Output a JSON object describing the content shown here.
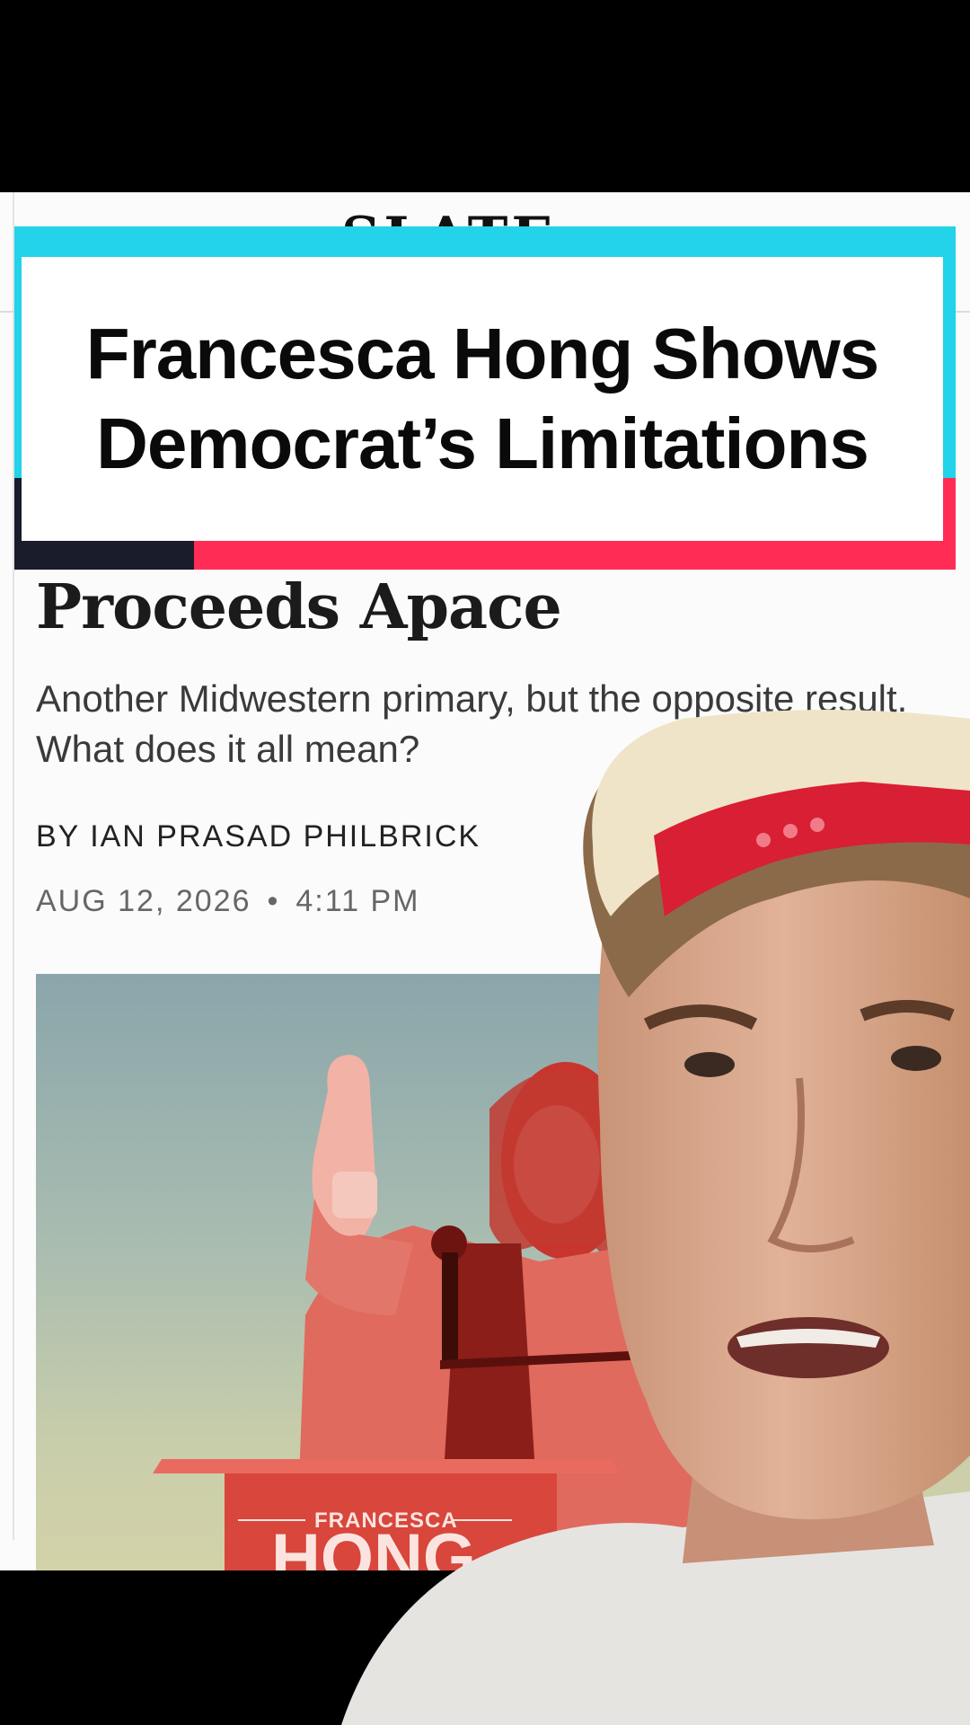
{
  "overlay": {
    "title_line1": "Francesca Hong Shows",
    "title_line2": "Democrat’s Limitations"
  },
  "article": {
    "headline_tail": "Proceeds Apace",
    "dek": "Another Midwestern primary, but the opposite result. What does it all mean?",
    "byline": "BY IAN PRASAD PHILBRICK",
    "date": "AUG 12, 2026",
    "time": "4:11 PM",
    "date_separator": "•",
    "hero": {
      "podium_name_top": "FRANCESCA",
      "podium_name_bottom": "HONG"
    }
  },
  "colors": {
    "accent_cyan": "#22d3ea",
    "accent_pink": "#ff2d55",
    "accent_navy": "#1a1c2b",
    "duotone_red": "#e0463e"
  }
}
